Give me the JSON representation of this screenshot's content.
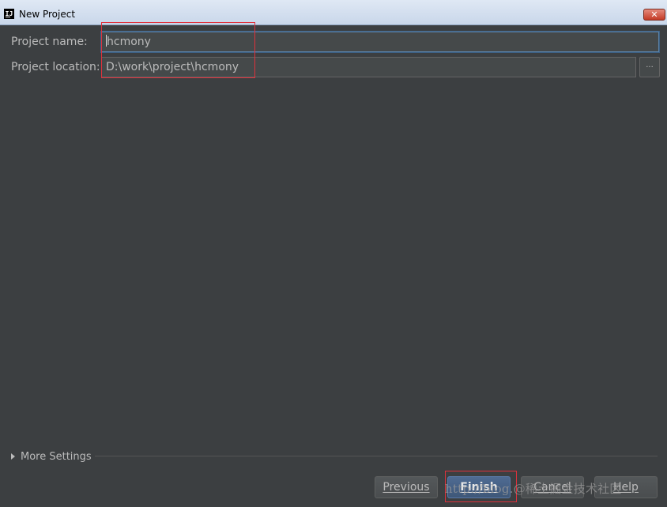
{
  "window": {
    "title": "New Project",
    "app_icon_text": "IJ",
    "close_glyph": "✕"
  },
  "form": {
    "name_label": "Project name:",
    "name_value": "hcmony",
    "location_label": "Project location:",
    "location_value": "D:\\work\\project\\hcmony",
    "browse_label": "..."
  },
  "more_settings": {
    "label": "More Settings",
    "expanded": false
  },
  "buttons": {
    "previous": "Previous",
    "finish": "Finish",
    "cancel": "Cancel",
    "help": "Help"
  },
  "watermark": "http://blog.@稀土掘金技术社区",
  "colors": {
    "dialog_bg": "#3c3f41",
    "field_bg": "#45494a",
    "text": "#bbbbbb",
    "focus_border": "#5c83a8",
    "default_button": "#4f6b93",
    "highlight_box": "#e0313c"
  }
}
